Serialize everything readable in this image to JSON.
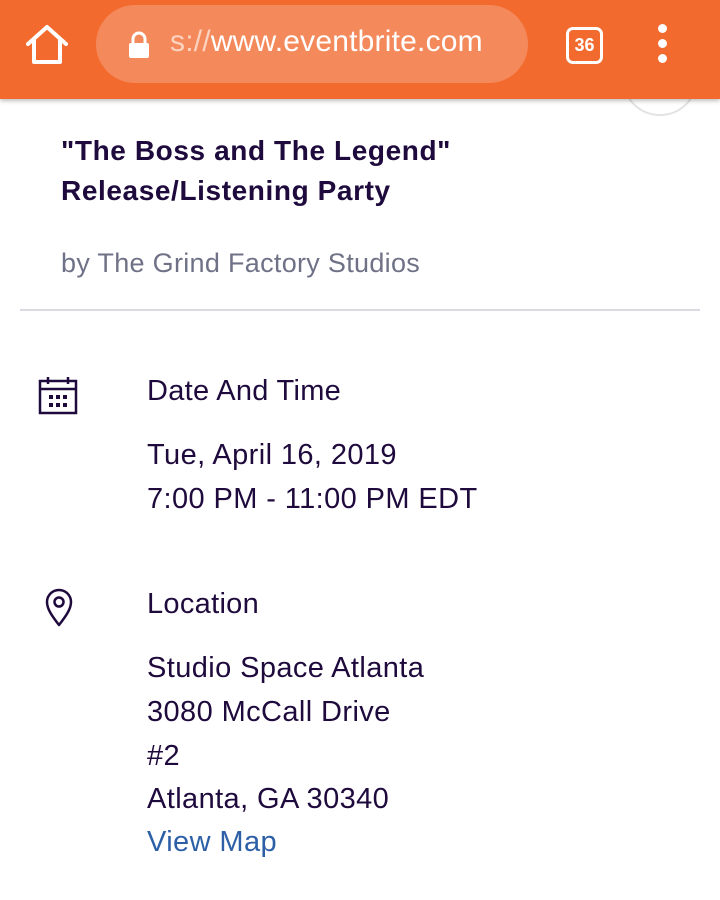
{
  "browser": {
    "url_scheme": "s://",
    "url_host": "www.eventbrite.com",
    "tab_count": "36",
    "icons": [
      "home-icon",
      "lock-icon",
      "tab-switcher-icon",
      "more-vert-icon"
    ],
    "accent_color": "#f26a2e"
  },
  "event": {
    "title_line1": "\"The Boss and The Legend\"",
    "title_line2": "Release/Listening Party",
    "organizer": "by The Grind Factory Studios"
  },
  "date_time": {
    "heading": "Date And Time",
    "date": "Tue, April 16, 2019",
    "time": "7:00 PM - 11:00 PM EDT",
    "icon": "calendar-icon"
  },
  "location": {
    "heading": "Location",
    "venue": "Studio Space Atlanta",
    "street": "3080 McCall Drive",
    "unit": "#2",
    "city": "Atlanta, GA 30340",
    "map_link": "View Map",
    "icon": "map-pin-icon"
  }
}
